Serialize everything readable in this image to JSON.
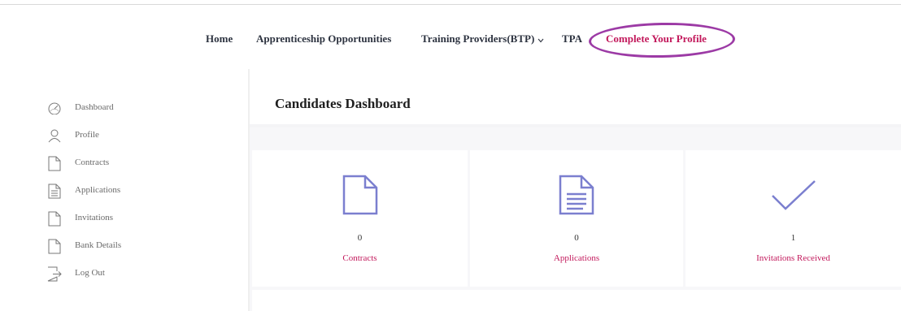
{
  "nav": {
    "home": "Home",
    "opportunities": "Apprenticeship Opportunities",
    "training_providers": "Training Providers(BTP)",
    "tpa": "TPA",
    "complete_profile": "Complete Your Profile"
  },
  "sidebar": {
    "items": [
      {
        "label": "Dashboard",
        "icon": "dashboard-gauge-icon"
      },
      {
        "label": "Profile",
        "icon": "user-icon"
      },
      {
        "label": "Contracts",
        "icon": "document-icon"
      },
      {
        "label": "Applications",
        "icon": "document-lines-icon"
      },
      {
        "label": "Invitations",
        "icon": "document-icon"
      },
      {
        "label": "Bank Details",
        "icon": "document-icon"
      },
      {
        "label": "Log Out",
        "icon": "logout-icon"
      }
    ]
  },
  "main": {
    "title": "Candidates Dashboard",
    "cards": [
      {
        "count": "0",
        "label": "Contracts",
        "icon": "document-icon"
      },
      {
        "count": "0",
        "label": "Applications",
        "icon": "document-lines-icon"
      },
      {
        "count": "1",
        "label": "Invitations Received",
        "icon": "checkmark-icon"
      }
    ]
  },
  "colors": {
    "accent": "#c2185b",
    "icon_purple": "#7b7fcf",
    "highlight_ring": "#9c3aa5",
    "nav_text": "#2d3340"
  }
}
